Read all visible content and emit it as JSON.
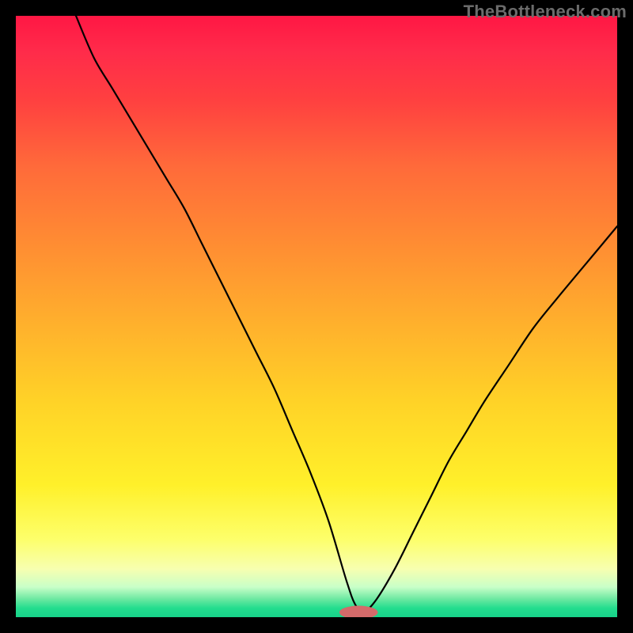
{
  "watermark": "TheBottleneck.com",
  "colors": {
    "frame": "#000000",
    "curve": "#000000",
    "marker": "#d46a6a",
    "gradient_stops": [
      "#ff1744",
      "#ff2b4a",
      "#ff4040",
      "#ff6a3a",
      "#ff8a33",
      "#ffad2d",
      "#ffd227",
      "#fff02a",
      "#fdff6a",
      "#f7ffb0",
      "#c8ffc8",
      "#6be8a1",
      "#23dd8e",
      "#18d28a"
    ]
  },
  "chart_data": {
    "type": "line",
    "title": "",
    "xlabel": "",
    "ylabel": "",
    "xlim": [
      0,
      100
    ],
    "ylim": [
      0,
      100
    ],
    "x": [
      10,
      13,
      16,
      19,
      22,
      25,
      28,
      31,
      34,
      37,
      40,
      43,
      46,
      49,
      52,
      55,
      56.5,
      58,
      60,
      63,
      66,
      69,
      72,
      75,
      78,
      82,
      86,
      90,
      95,
      100
    ],
    "values": [
      100,
      93,
      88,
      83,
      78,
      73,
      68,
      62,
      56,
      50,
      44,
      38,
      31,
      24,
      16,
      6,
      2,
      1,
      3,
      8,
      14,
      20,
      26,
      31,
      36,
      42,
      48,
      53,
      59,
      65
    ],
    "marker": {
      "x": 57,
      "y": 0.8,
      "rx": 3.2,
      "ry": 1.1
    },
    "annotations": [],
    "legend": []
  }
}
